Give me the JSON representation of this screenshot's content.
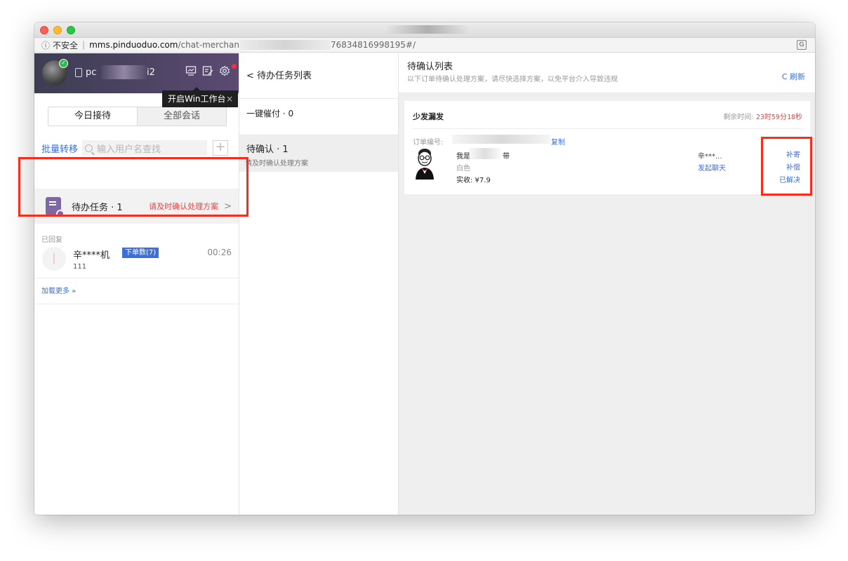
{
  "browser": {
    "security_label": "不安全",
    "url_host": "mms.pinduoduo.com",
    "url_path_start": "/chat-merchan",
    "url_path_end": "76834816998195#/"
  },
  "profile": {
    "name_start": "pc",
    "name_end": "i2"
  },
  "tooltip": {
    "label": "开启Win工作台",
    "close": "×"
  },
  "tabs": [
    {
      "label": "今日接待",
      "active": true
    },
    {
      "label": "全部会话",
      "active": false
    }
  ],
  "toolbar": {
    "batch_label": "批量转移",
    "search_placeholder": "输入用户名查找",
    "add_label": "+"
  },
  "todo": {
    "title": "待办任务 · 1",
    "warning": "请及时确认处理方案",
    "arrow": ">"
  },
  "section_label": "已回复",
  "chat": {
    "name": "辛****机",
    "badge": "下单数(7)",
    "time": "00:26",
    "message": "111"
  },
  "load_more": "加载更多 »",
  "middle": {
    "header": "< 待办任务列表",
    "items": [
      {
        "title": "一键催付 · 0"
      },
      {
        "title": "待确认 · 1",
        "subtitle": "请及时确认处理方案"
      }
    ]
  },
  "right": {
    "title": "待确认列表",
    "subtitle": "以下订单待确认处理方案，请尽快选择方案，以免平台介入导致违规",
    "refresh": "C 刷新",
    "card": {
      "type": "少发漏发",
      "time_label": "剩余时间: ",
      "time_value": "23时59分18秒",
      "order_label": "订单编号:",
      "copy": "复制",
      "product_name_start": "我是",
      "product_name_end": "带",
      "spec": "白色",
      "price": "实收: ¥7.9",
      "buyer": "辛***...",
      "chat_action": "发起聊天",
      "actions": [
        "补寄",
        "补偿",
        "已解决"
      ]
    }
  },
  "colors": {
    "accent": "#3a6fd8",
    "warning": "#e84343",
    "highlight_box": "#ff2a1a",
    "profile_bg": "#4a4262"
  }
}
